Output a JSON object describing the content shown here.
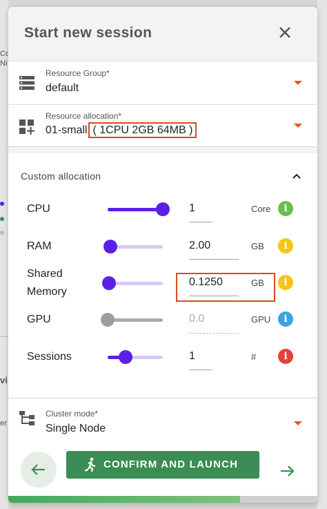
{
  "background": {
    "left_snippets": [
      "Co",
      "Ni"
    ],
    "left_word": "vi",
    "left_word2": "er"
  },
  "dialog": {
    "title": "Start new session",
    "close_icon": "close-icon"
  },
  "resource_group": {
    "label": "Resource Group*",
    "value": "default",
    "icon": "server-rack-icon"
  },
  "resource_allocation": {
    "label": "Resource allocation*",
    "preset": "01-small",
    "spec": "( 1CPU 2GB 64MB )",
    "icon": "grid-plus-icon"
  },
  "custom_allocation": {
    "title": "Custom allocation",
    "rows": [
      {
        "label": "CPU",
        "value": "1",
        "unit": "Core",
        "level": 1.0,
        "info_color": "#6abf4b",
        "enabled": true
      },
      {
        "label": "RAM",
        "value": "2.00",
        "unit": "GB",
        "level": 0.05,
        "info_color": "#f5c518",
        "enabled": true
      },
      {
        "label_line1": "Shared",
        "label_line2": "Memory",
        "value": "0.1250",
        "unit": "GB",
        "level": 0.02,
        "info_color": "#f5c518",
        "enabled": true
      },
      {
        "label": "GPU",
        "value": "0.0",
        "unit": "GPU",
        "level": 0.0,
        "info_color": "#3aa3e3",
        "enabled": false
      },
      {
        "label": "Sessions",
        "value": "1",
        "unit": "#",
        "level": 0.33,
        "info_color": "#e0443a",
        "enabled": true
      }
    ]
  },
  "cluster_mode": {
    "label": "Cluster mode*",
    "value": "Single Node",
    "icon": "cluster-icon"
  },
  "footer": {
    "back_icon": "arrow-left-icon",
    "launch_label": "CONFIRM AND LAUNCH",
    "launch_icon": "running-person-icon",
    "next_icon": "arrow-right-icon"
  },
  "progress": {
    "fraction": 0.75
  },
  "colors": {
    "accent": "#5b1fe6",
    "dropdown": "#e8541e",
    "launch": "#3a8d55",
    "highlight": "#d84a1c"
  }
}
